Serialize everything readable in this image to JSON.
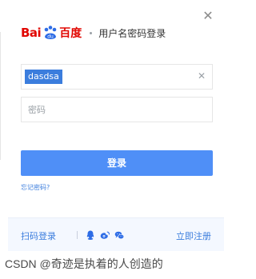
{
  "header": {
    "brand_bai": "Bai",
    "brand_du": "百度",
    "title": "用户名密码登录"
  },
  "form": {
    "username_value": "dasdsa",
    "password_placeholder": "密码",
    "login_label": "登录",
    "forgot_label": "忘记密码?"
  },
  "footer": {
    "scan_login_label": "扫码登录",
    "register_label": "立即注册",
    "social_icons": [
      "qq-icon",
      "weibo-icon",
      "wechat-icon"
    ]
  },
  "colors": {
    "brand_red": "#e10601",
    "primary_blue": "#4f8ff7",
    "link_blue": "#3b7ddd",
    "footer_bg": "#f4f8ff"
  },
  "watermark": "CSDN @奇迹是执着的人创造的"
}
